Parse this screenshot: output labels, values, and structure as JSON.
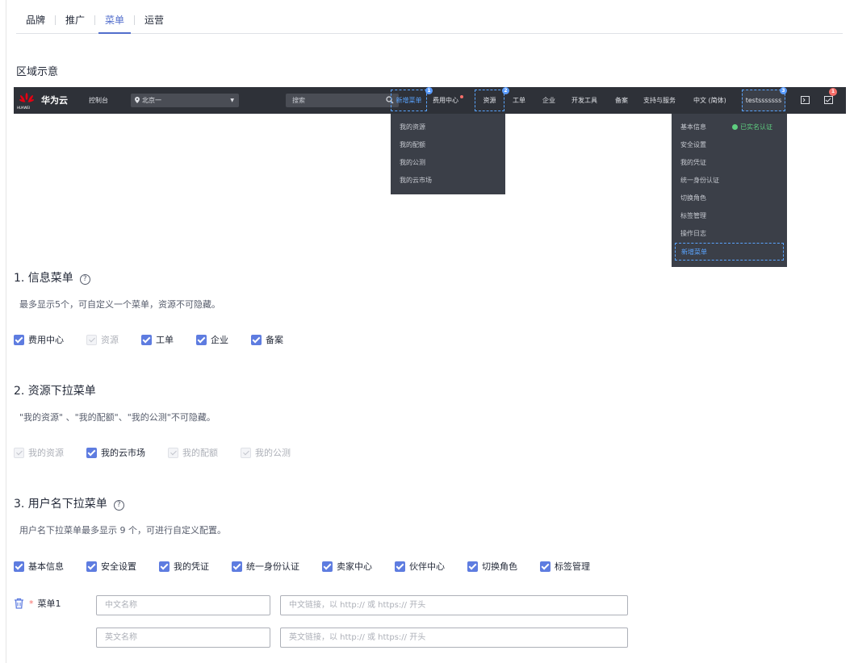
{
  "tabs": [
    {
      "label": "品牌",
      "active": false
    },
    {
      "label": "推广",
      "active": false
    },
    {
      "label": "菜单",
      "active": true
    },
    {
      "label": "运营",
      "active": false
    }
  ],
  "area_title": "区域示意",
  "preview": {
    "logo_text": "HUAWEI",
    "brand": "华为云",
    "console": "控制台",
    "region": "北京一",
    "search_placeholder": "搜索",
    "nav": [
      "新增菜单",
      "费用中心",
      "资源",
      "工单",
      "企业",
      "开发工具",
      "备案",
      "支持与服务",
      "中文 (简体)",
      "testsssssss"
    ],
    "badges": [
      "1",
      "2",
      "3",
      "1"
    ],
    "resource_dropdown": [
      "我的资源",
      "我的配额",
      "我的公测",
      "我的云市场"
    ],
    "user_dropdown": [
      "基本信息",
      "安全设置",
      "我的凭证",
      "统一身份认证",
      "切换角色",
      "标签管理",
      "操作日志",
      "新增菜单"
    ],
    "verified": "已实名认证"
  },
  "section1": {
    "title": "1. 信息菜单",
    "desc": "最多显示5个，可自定义一个菜单，资源不可隐藏。",
    "options": [
      {
        "label": "费用中心",
        "checked": true,
        "disabled": false
      },
      {
        "label": "资源",
        "checked": true,
        "disabled": true
      },
      {
        "label": "工单",
        "checked": true,
        "disabled": false
      },
      {
        "label": "企业",
        "checked": true,
        "disabled": false
      },
      {
        "label": "备案",
        "checked": true,
        "disabled": false
      }
    ]
  },
  "section2": {
    "title": "2. 资源下拉菜单",
    "desc": "\"我的资源\" 、\"我的配额\"、\"我的公测\"不可隐藏。",
    "options": [
      {
        "label": "我的资源",
        "checked": true,
        "disabled": true
      },
      {
        "label": "我的云市场",
        "checked": true,
        "disabled": false
      },
      {
        "label": "我的配额",
        "checked": true,
        "disabled": true
      },
      {
        "label": "我的公测",
        "checked": true,
        "disabled": true
      }
    ]
  },
  "section3": {
    "title": "3. 用户名下拉菜单",
    "desc": "用户名下拉菜单最多显示 9 个，可进行自定义配置。",
    "options": [
      {
        "label": "基本信息",
        "checked": true
      },
      {
        "label": "安全设置",
        "checked": true
      },
      {
        "label": "我的凭证",
        "checked": true
      },
      {
        "label": "统一身份认证",
        "checked": true
      },
      {
        "label": "卖家中心",
        "checked": true
      },
      {
        "label": "伙伴中心",
        "checked": true
      },
      {
        "label": "切换角色",
        "checked": true
      },
      {
        "label": "标签管理",
        "checked": true
      }
    ],
    "menu_label": "菜单1",
    "cn_name_placeholder": "中文名称",
    "cn_link_placeholder": "中文链接，以 http:// 或 https:// 开头",
    "en_name_placeholder": "英文名称",
    "en_link_placeholder": "英文链接，以 http:// 或 https:// 开头"
  },
  "colors": {
    "primary": "#5e7ce0",
    "header_bg": "#2e3138",
    "highlight": "#5aa4ff"
  }
}
